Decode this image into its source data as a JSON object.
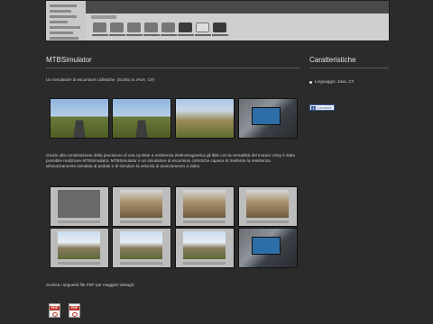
{
  "main": {
    "title": "MTBSimulator",
    "intro": "Un simulatore di escursioni ciclistiche. (Scritto in JAVA, C#)",
    "description": "Grazie alla combinazione della precisione di una cyclette a resistenza elettromagnetica gli ibile con la versatilità del motore Unity è stato possibile realizzare MTBSimulator. MTBSimulator è un simulatore di escursioni ciclistiche capace di trasferire la resistenza all'avanzamento simulata al pedale e di simulare la velocità di avanzamento a video.",
    "downloads_text": "Scarica i seguenti file PDF per maggiori dettagli:",
    "pdf_label": "PDF"
  },
  "sidebar": {
    "title": "Caratteristiche",
    "language": "Linguaggio: Java, C#",
    "share_label": "Condividi",
    "share_icon": "f"
  },
  "colors": {
    "background": "#2b2b2b",
    "facebook": "#3b5998",
    "pdf_red": "#c0392b"
  },
  "icons": [
    "bullet-icon",
    "facebook-icon",
    "pdf-icon"
  ]
}
